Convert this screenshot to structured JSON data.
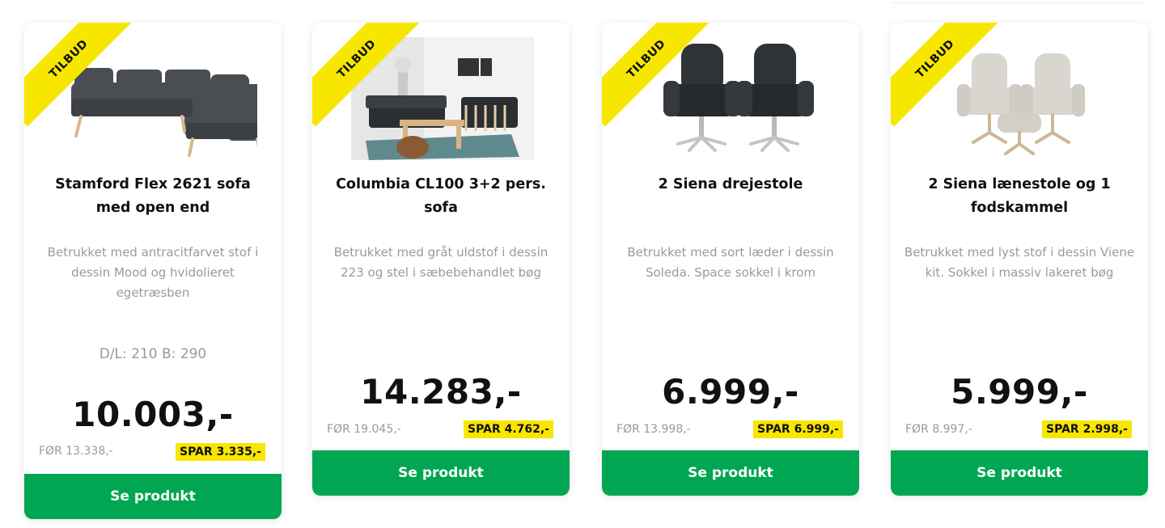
{
  "badge_label": "TILBUD",
  "colors": {
    "badge": "#f7e600",
    "cta": "#00a651",
    "muted_text": "#9a9a9a"
  },
  "products": [
    {
      "title": "Stamford Flex 2621 sofa med open end",
      "description": "Betrukket med antracitfarvet stof i dessin Mood og hvidolieret egetræsben",
      "dimensions": "D/L: 210 B: 290",
      "price": "10.003,-",
      "before_price": "FØR 13.338,-",
      "savings": "SPAR 3.335,-",
      "cta_label": "Se produkt",
      "image": "grey corner sofa"
    },
    {
      "title": "Columbia CL100 3+2 pers. sofa",
      "description": "Betrukket med gråt uldstof i dessin 223 og stel i sæbebehandlet bøg",
      "price": "14.283,-",
      "before_price": "FØR 19.045,-",
      "savings": "SPAR 4.762,-",
      "cta_label": "Se produkt",
      "image": "living room with sofas"
    },
    {
      "title": "2 Siena drejestole",
      "description": "Betrukket med sort læder i dessin Soleda. Space sokkel i krom",
      "price": "6.999,-",
      "before_price": "FØR 13.998,-",
      "savings": "SPAR 6.999,-",
      "cta_label": "Se produkt",
      "image": "two black swivel chairs"
    },
    {
      "title": "2 Siena lænestole og 1 fodskammel",
      "description": "Betrukket med lyst stof i dessin Viene kit. Sokkel i massiv lakeret bøg",
      "price": "5.999,-",
      "before_price": "FØR 8.997,-",
      "savings": "SPAR 2.998,-",
      "cta_label": "Se produkt",
      "image": "two light armchairs with footstool"
    }
  ]
}
